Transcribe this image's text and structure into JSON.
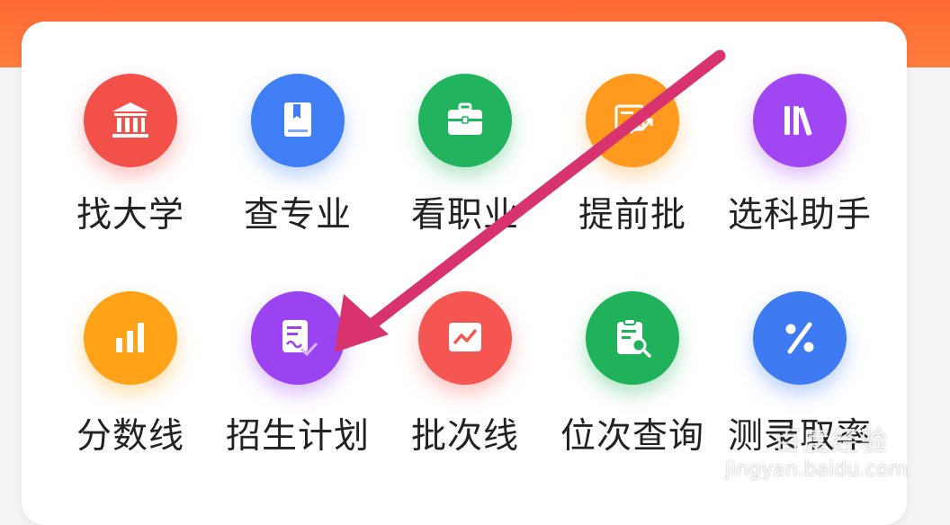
{
  "menu": {
    "row1": [
      {
        "label": "找大学",
        "icon": "university-icon",
        "color": "#f4504a"
      },
      {
        "label": "查专业",
        "icon": "book-icon",
        "color": "#3f7ef4"
      },
      {
        "label": "看职业",
        "icon": "briefcase-icon",
        "color": "#21b35e"
      },
      {
        "label": "提前批",
        "icon": "chart-trend-icon",
        "color": "#ff9a1f"
      },
      {
        "label": "选科助手",
        "icon": "books-shelf-icon",
        "color": "#a046f2"
      }
    ],
    "row2": [
      {
        "label": "分数线",
        "icon": "bar-chart-icon",
        "color": "#ffa218"
      },
      {
        "label": "招生计划",
        "icon": "document-check-icon",
        "color": "#9b43f0"
      },
      {
        "label": "批次线",
        "icon": "line-chart-icon",
        "color": "#f55651"
      },
      {
        "label": "位次查询",
        "icon": "clipboard-search-icon",
        "color": "#1fb25a"
      },
      {
        "label": "测录取率",
        "icon": "percent-icon",
        "color": "#3e7bf2"
      }
    ]
  },
  "annotation": {
    "arrow_color": "#d8336f"
  },
  "watermark": {
    "brand": "百度经验",
    "url": "jingyan.baidu.com"
  }
}
